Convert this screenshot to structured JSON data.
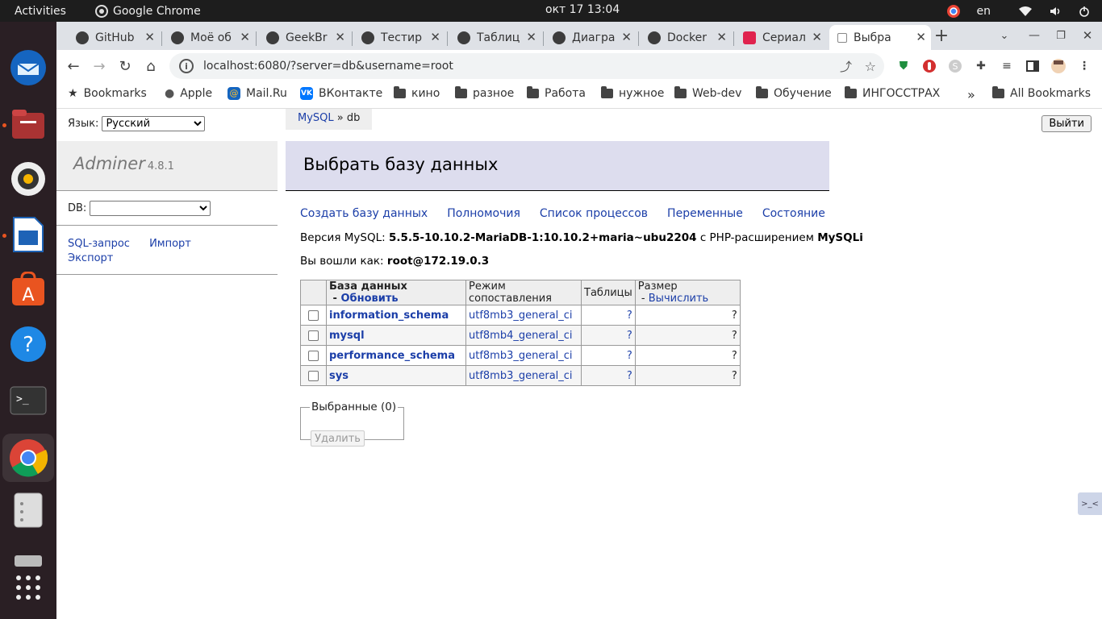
{
  "topbar": {
    "activities": "Activities",
    "app_name": "Google Chrome",
    "clock": "окт 17  13:04",
    "lang": "en"
  },
  "chrome": {
    "tabs": [
      {
        "label": "GitHub"
      },
      {
        "label": "Моё об"
      },
      {
        "label": "GeekBr"
      },
      {
        "label": "Тестир"
      },
      {
        "label": "Таблиц"
      },
      {
        "label": "Диагра"
      },
      {
        "label": "Docker"
      },
      {
        "label": "Сериал"
      },
      {
        "label": "Выбра"
      }
    ],
    "url": "localhost:6080/?server=db&username=root",
    "bookmarks": [
      {
        "label": "Bookmarks",
        "icon": "star-icon"
      },
      {
        "label": "Apple",
        "icon": "apple-icon"
      },
      {
        "label": "Mail.Ru",
        "icon": "mailru-icon"
      },
      {
        "label": "ВКонтакте",
        "icon": "vk-icon"
      },
      {
        "label": "кино",
        "icon": "folder-icon"
      },
      {
        "label": "разное",
        "icon": "folder-icon"
      },
      {
        "label": "Работа",
        "icon": "folder-icon"
      },
      {
        "label": "нужное",
        "icon": "folder-icon"
      },
      {
        "label": "Web-dev",
        "icon": "folder-icon"
      },
      {
        "label": "Обучение",
        "icon": "folder-icon"
      },
      {
        "label": "ИНГОССТРАХ",
        "icon": "folder-icon"
      }
    ],
    "more": "»",
    "all_bookmarks": "All Bookmarks"
  },
  "adminer": {
    "lang_label": "Язык:",
    "lang_value": "Русский",
    "breadcrumb_link": "MySQL",
    "breadcrumb_sep": " » ",
    "breadcrumb_current": "db",
    "logout": "Выйти",
    "logo": "Adminer",
    "version": "4.8.1",
    "db_label": "DB:",
    "links": {
      "sql": "SQL-запрос",
      "import": "Импорт",
      "export": "Экспорт"
    },
    "title": "Выбрать базу данных",
    "actions": {
      "create": "Создать базу данных",
      "privileges": "Полномочия",
      "processes": "Список процессов",
      "variables": "Переменные",
      "status": "Состояние"
    },
    "version_line": {
      "prefix": "Версия MySQL: ",
      "version": "5.5.5-10.10.2-MariaDB-1:10.10.2+maria~ubu2204",
      "middle": " с PHP-расширением ",
      "ext": "MySQLi"
    },
    "login_line": {
      "prefix": "Вы вошли как: ",
      "user": "root@172.19.0.3"
    },
    "table": {
      "headers": {
        "db": "База данных",
        "sep": " - ",
        "refresh": "Обновить",
        "collation": "Режим сопоставления",
        "tables": "Таблицы",
        "size": "Размер",
        "compute": "Вычислить"
      },
      "rows": [
        {
          "name": "information_schema",
          "collation": "utf8mb3_general_ci",
          "tables": "?",
          "size": "?"
        },
        {
          "name": "mysql",
          "collation": "utf8mb4_general_ci",
          "tables": "?",
          "size": "?"
        },
        {
          "name": "performance_schema",
          "collation": "utf8mb3_general_ci",
          "tables": "?",
          "size": "?"
        },
        {
          "name": "sys",
          "collation": "utf8mb3_general_ci",
          "tables": "?",
          "size": "?"
        }
      ]
    },
    "selected_legend": "Выбранные (0)",
    "delete_button": "Удалить"
  }
}
